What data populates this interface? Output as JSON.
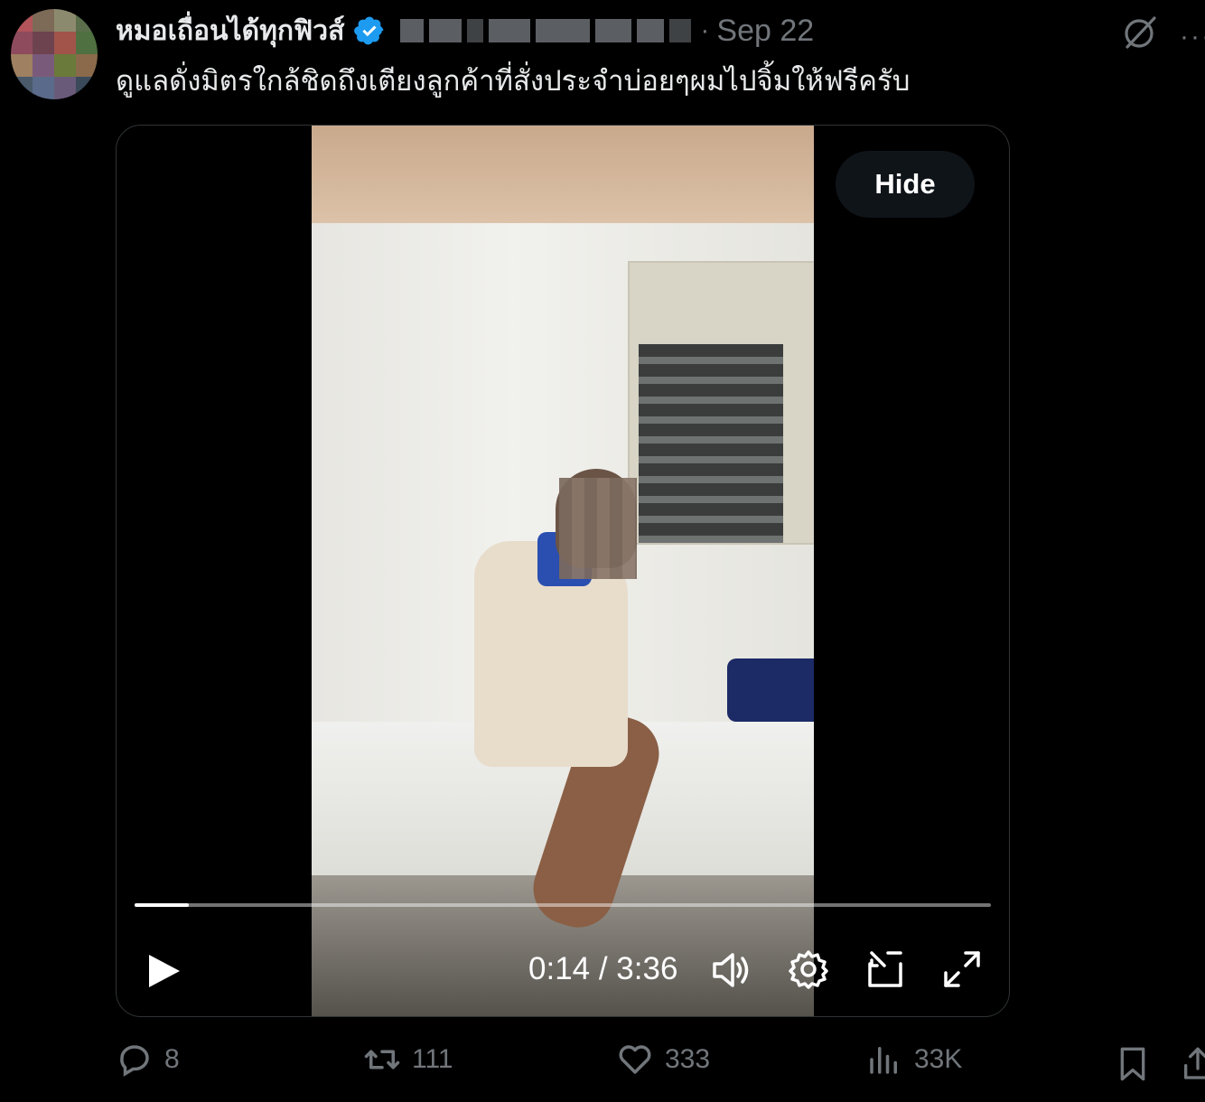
{
  "tweet": {
    "display_name": "หมอเถื่อนได้ทุกฟิวส์",
    "date": "Sep 22",
    "separator": "·",
    "text": "ดูแลดั่งมิตรใกล้ชิดถึงเตียงลูกค้าที่สั่งประจำบ่อยๆผมไปจิ้มให้ฟรีครับ"
  },
  "video": {
    "hide_label": "Hide",
    "time_display": "0:14 / 3:36",
    "progress_fraction": 0.063
  },
  "actions": {
    "replies": "8",
    "retweets": "111",
    "likes": "333",
    "views": "33K"
  },
  "colors": {
    "background": "#000000",
    "text_primary": "#e7e9ea",
    "text_secondary": "#71767b",
    "verified_badge": "#1d9bf0",
    "hide_button_bg": "#0f1419"
  },
  "icons": {
    "verified": "verified-badge-icon",
    "grok": "grok-icon",
    "more": "more-icon",
    "play": "play-icon",
    "volume": "volume-icon",
    "settings": "settings-icon",
    "pip": "pip-icon",
    "fullscreen": "fullscreen-icon",
    "reply": "reply-icon",
    "retweet": "retweet-icon",
    "like": "heart-icon",
    "views": "views-icon",
    "bookmark": "bookmark-icon",
    "share": "share-icon"
  }
}
